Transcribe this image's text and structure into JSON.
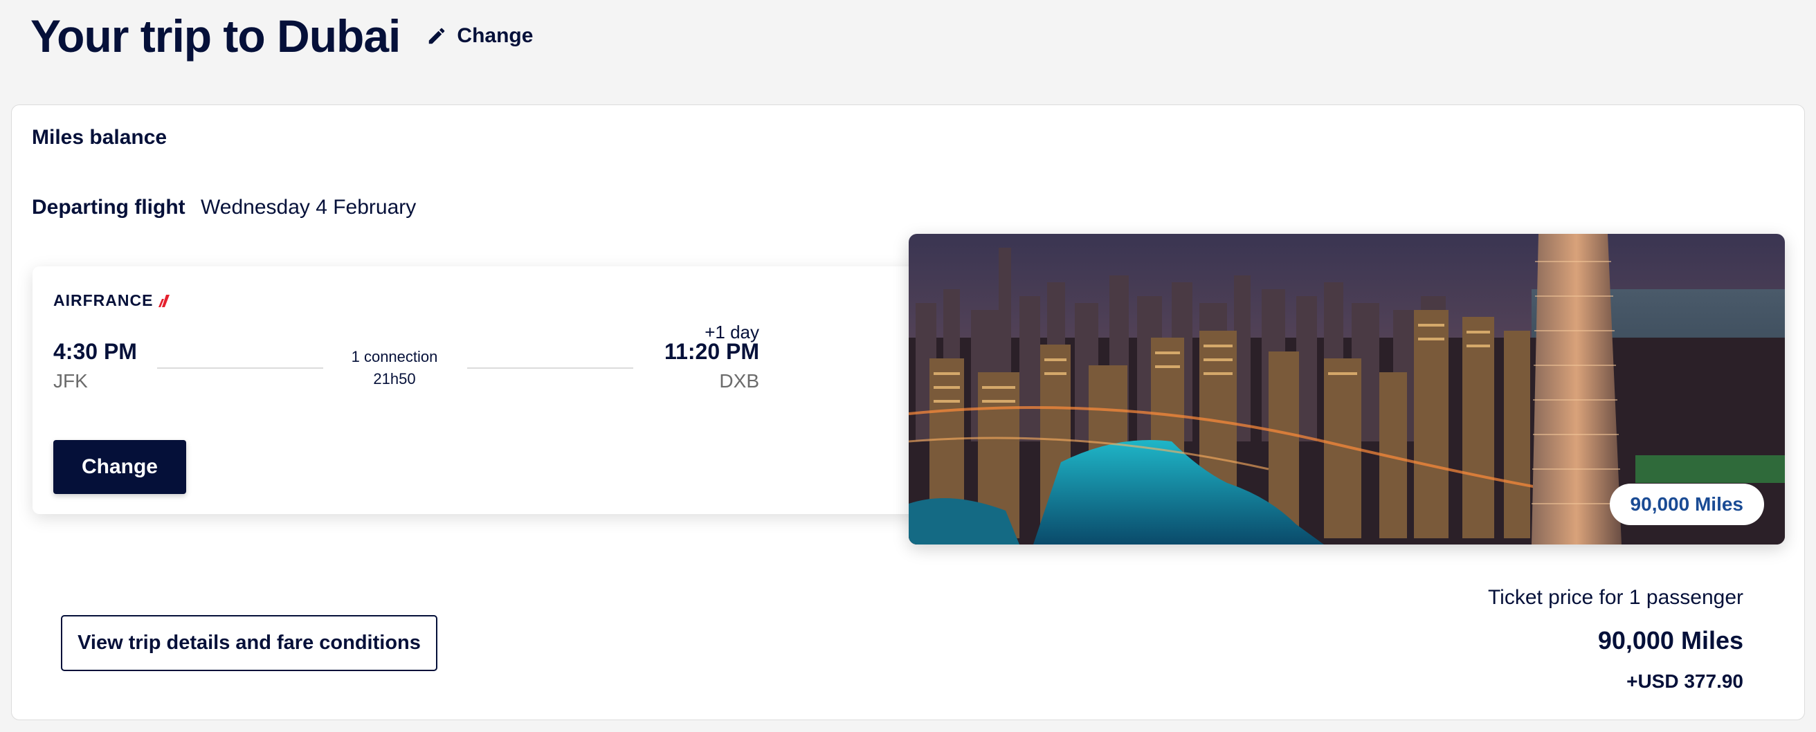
{
  "header": {
    "title": "Your trip to Dubai",
    "change_label": "Change",
    "change_icon": "pencil-icon"
  },
  "miles_balance": {
    "label": "Miles balance"
  },
  "departing": {
    "label": "Departing flight",
    "date": "Wednesday 4 February"
  },
  "flight": {
    "airline": "AIRFRANCE",
    "departure_time": "4:30 PM",
    "departure_code": "JFK",
    "connection": "1 connection",
    "duration": "21h50",
    "day_offset": "+1 day",
    "arrival_time": "11:20 PM",
    "arrival_code": "DXB",
    "change_label": "Change"
  },
  "destination_image": {
    "badge": "90,000 Miles"
  },
  "details_button": {
    "label": "View trip details and fare conditions"
  },
  "price": {
    "label": "Ticket price for 1 passenger",
    "miles": "90,000 Miles",
    "usd": "+USD 377.90"
  },
  "colors": {
    "navy": "#051039",
    "badge_text": "#1a4b94",
    "airline_red": "#e5202e",
    "page_bg": "#f4f4f4"
  }
}
